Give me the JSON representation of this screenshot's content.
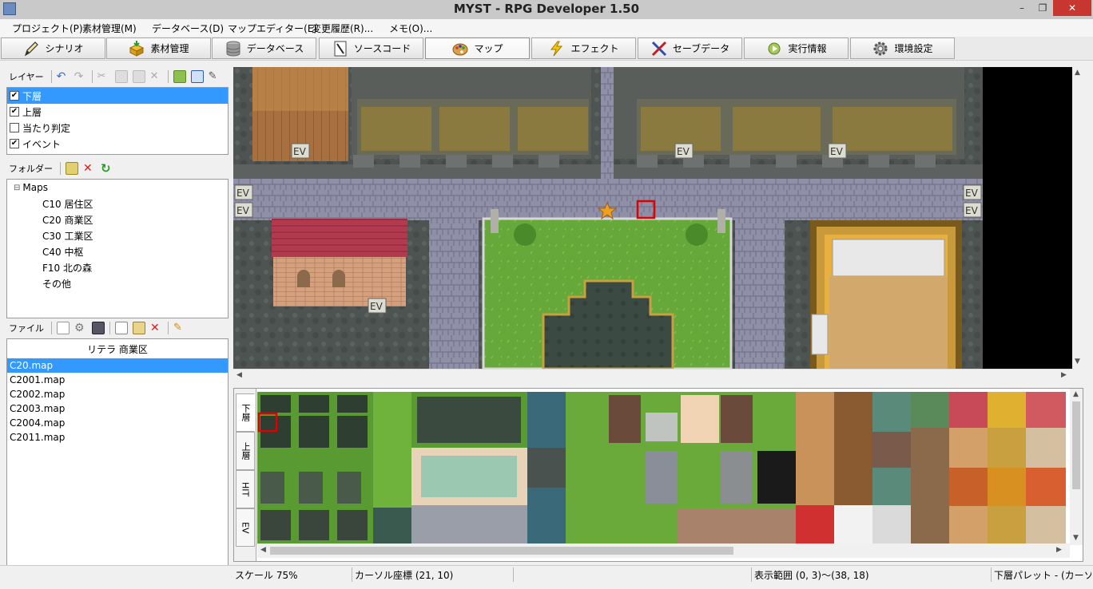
{
  "window": {
    "title": "MYST - RPG Developer 1.50",
    "minimize": "–",
    "maximize": "❐",
    "close": "✕"
  },
  "menu": [
    "プロジェクト(P)",
    "素材管理(M)",
    "データベース(D)",
    "マップエディター(E)",
    "変更履歴(R)...",
    "メモ(O)..."
  ],
  "toolbar": [
    {
      "label": "シナリオ",
      "icon": "pen-icon",
      "color": "#333333"
    },
    {
      "label": "素材管理",
      "icon": "package-icon",
      "color": "#d8a020"
    },
    {
      "label": "データベース",
      "icon": "database-icon",
      "color": "#888888"
    },
    {
      "label": "ソースコード",
      "icon": "source-code-icon",
      "color": "#555555"
    },
    {
      "label": "マップ",
      "icon": "palette-icon",
      "color": "#c98a2a"
    },
    {
      "label": "エフェクト",
      "icon": "lightning-icon",
      "color": "#f0c000"
    },
    {
      "label": "セーブデータ",
      "icon": "tools-icon",
      "color": "#2c4fb0"
    },
    {
      "label": "実行情報",
      "icon": "run-icon",
      "color": "#8bb040"
    },
    {
      "label": "環境設定",
      "icon": "gear-icon",
      "color": "#777777"
    }
  ],
  "active_tool": "マップ",
  "layers": {
    "label": "レイヤー",
    "items": [
      {
        "label": "下層",
        "checked": true,
        "selected": true
      },
      {
        "label": "上層",
        "checked": true,
        "selected": false
      },
      {
        "label": "当たり判定",
        "checked": false,
        "selected": false
      },
      {
        "label": "イベント",
        "checked": true,
        "selected": false
      }
    ]
  },
  "folders": {
    "label": "フォルダー",
    "root": "Maps",
    "root_toggle": "⊟",
    "items": [
      "C10 居住区",
      "C20 商業区",
      "C30 工業区",
      "C40 中枢",
      "F10 北の森",
      "その他"
    ]
  },
  "files": {
    "label": "ファイル",
    "header": "リテラ 商業区",
    "items": [
      "C20.map",
      "C2001.map",
      "C2002.map",
      "C2003.map",
      "C2004.map",
      "C2011.map"
    ],
    "selected": 0
  },
  "map": {
    "event_marker": "EV"
  },
  "palette_tabs": [
    "下層",
    "上層",
    "HIT",
    "EV"
  ],
  "status": {
    "scale": "スケール 75%",
    "cursor": "カーソル座標 (21, 10)",
    "range": "表示範囲 (0, 3)～(38, 18)",
    "palette": "下層パレット - (カーソル)"
  }
}
